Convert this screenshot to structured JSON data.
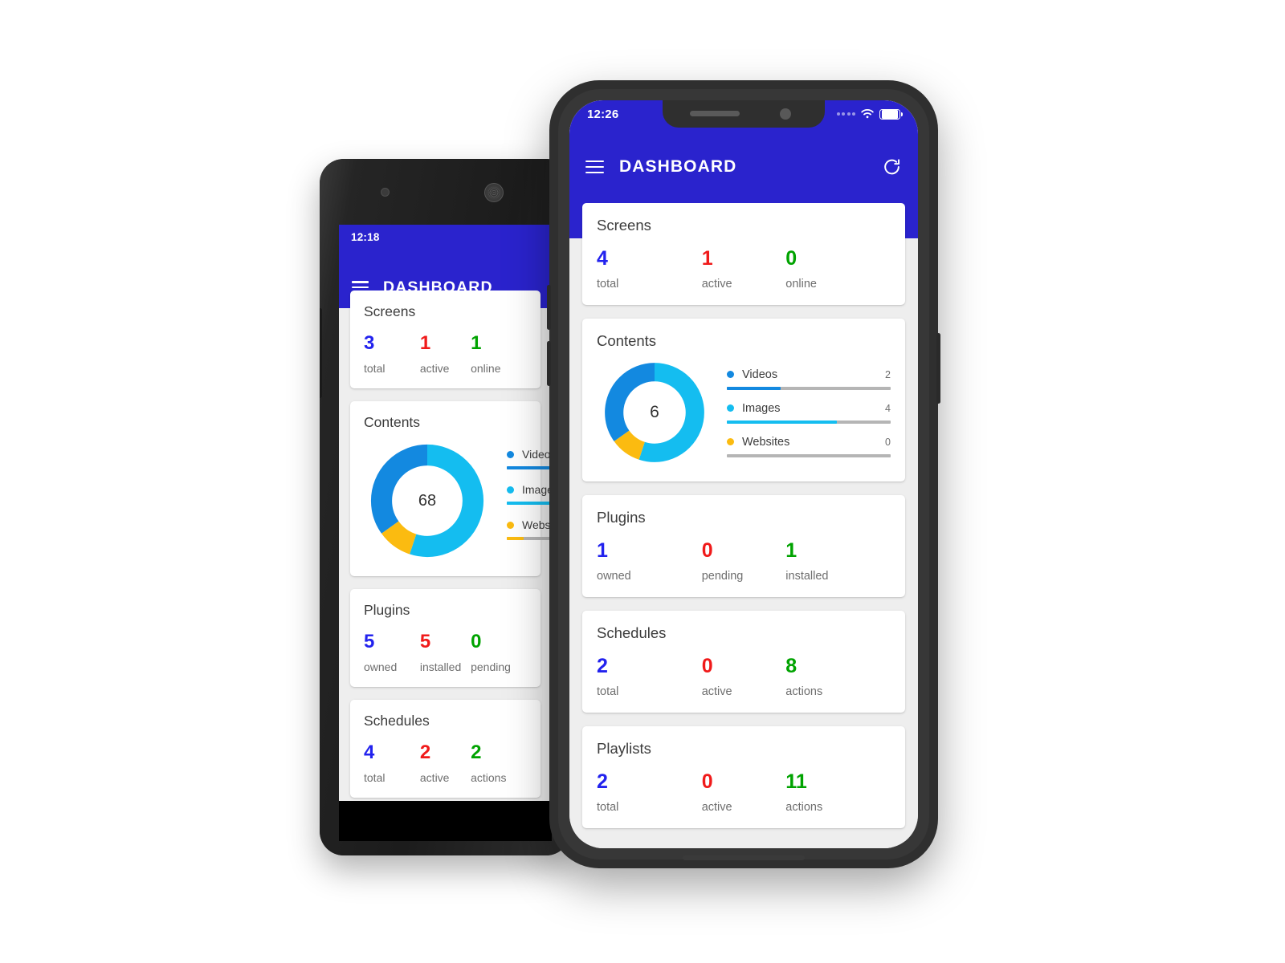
{
  "colors": {
    "brand_blue": "#2a23cd",
    "stat_blue": "#2222ee",
    "stat_red": "#f01a1a",
    "stat_green": "#00a300",
    "videos": "#1389e0",
    "images": "#14bdf0",
    "websites": "#fbbb10",
    "track": "#b5b5b5",
    "screen_bg": "#eeeeee",
    "card_bg": "#ffffff"
  },
  "iphone": {
    "status_bar": {
      "time": "12:26",
      "wifi_icon": "wifi-icon",
      "battery_icon": "battery-icon",
      "signal_icon": "signal-dots-icon"
    },
    "appbar": {
      "menu_icon": "hamburger-menu-icon",
      "title": "DASHBOARD",
      "refresh_icon": "refresh-icon"
    },
    "cards": [
      {
        "id": "screens",
        "title": "Screens",
        "type": "stats",
        "stats": [
          {
            "value": "4",
            "label": "total",
            "color": "#2222ee"
          },
          {
            "value": "1",
            "label": "active",
            "color": "#f01a1a"
          },
          {
            "value": "0",
            "label": "online",
            "color": "#00a300"
          }
        ]
      },
      {
        "id": "contents",
        "title": "Contents",
        "type": "donut",
        "center_value": "6",
        "legend": [
          {
            "name": "Videos",
            "value": "2",
            "color": "#1389e0",
            "fill_pct": 33
          },
          {
            "name": "Images",
            "value": "4",
            "color": "#14bdf0",
            "fill_pct": 67
          },
          {
            "name": "Websites",
            "value": "0",
            "color": "#fbbb10",
            "fill_pct": 0
          }
        ]
      },
      {
        "id": "plugins",
        "title": "Plugins",
        "type": "stats",
        "stats": [
          {
            "value": "1",
            "label": "owned",
            "color": "#2222ee"
          },
          {
            "value": "0",
            "label": "pending",
            "color": "#f01a1a"
          },
          {
            "value": "1",
            "label": "installed",
            "color": "#00a300"
          }
        ]
      },
      {
        "id": "schedules",
        "title": "Schedules",
        "type": "stats",
        "stats": [
          {
            "value": "2",
            "label": "total",
            "color": "#2222ee"
          },
          {
            "value": "0",
            "label": "active",
            "color": "#f01a1a"
          },
          {
            "value": "8",
            "label": "actions",
            "color": "#00a300"
          }
        ]
      },
      {
        "id": "playlists",
        "title": "Playlists",
        "type": "stats",
        "stats": [
          {
            "value": "2",
            "label": "total",
            "color": "#2222ee"
          },
          {
            "value": "0",
            "label": "active",
            "color": "#f01a1a"
          },
          {
            "value": "11",
            "label": "actions",
            "color": "#00a300"
          }
        ]
      }
    ]
  },
  "android": {
    "status_bar": {
      "time": "12:18"
    },
    "appbar": {
      "menu_icon": "hamburger-menu-icon",
      "title": "DASHBOARD"
    },
    "cards": [
      {
        "id": "screens",
        "title": "Screens",
        "type": "stats",
        "stats": [
          {
            "value": "3",
            "label": "total",
            "color": "#2222ee"
          },
          {
            "value": "1",
            "label": "active",
            "color": "#f01a1a"
          },
          {
            "value": "1",
            "label": "online",
            "color": "#00a300"
          }
        ]
      },
      {
        "id": "contents",
        "title": "Contents",
        "type": "donut",
        "center_value": "68",
        "legend": [
          {
            "name": "Videos",
            "value": "",
            "color": "#1389e0",
            "fill_pct": 100
          },
          {
            "name": "Images",
            "value": "",
            "color": "#14bdf0",
            "fill_pct": 100
          },
          {
            "name": "Websites",
            "value": "",
            "color": "#fbbb10",
            "fill_pct": 28
          }
        ]
      },
      {
        "id": "plugins",
        "title": "Plugins",
        "type": "stats",
        "stats": [
          {
            "value": "5",
            "label": "owned",
            "color": "#2222ee"
          },
          {
            "value": "5",
            "label": "installed",
            "color": "#f01a1a"
          },
          {
            "value": "0",
            "label": "pending",
            "color": "#00a300"
          }
        ]
      },
      {
        "id": "schedules",
        "title": "Schedules",
        "type": "stats",
        "stats": [
          {
            "value": "4",
            "label": "total",
            "color": "#2222ee"
          },
          {
            "value": "2",
            "label": "active",
            "color": "#f01a1a"
          },
          {
            "value": "2",
            "label": "actions",
            "color": "#00a300"
          }
        ]
      }
    ]
  },
  "chart_data": [
    {
      "type": "pie",
      "title": "Contents",
      "device": "iphone",
      "labels": [
        "Images",
        "Websites",
        "Videos"
      ],
      "values": [
        4,
        0.7,
        2.3
      ],
      "colors": [
        "#14bdf0",
        "#fbbb10",
        "#1389e0"
      ],
      "center_label": "6",
      "legend": "right",
      "note": "Donut starts at 12 o'clock clockwise: Images ~55%, Websites ~10%, Videos ~35%"
    },
    {
      "type": "pie",
      "title": "Contents",
      "device": "android",
      "labels": [
        "Images",
        "Websites",
        "Videos"
      ],
      "values": [
        55,
        10,
        35
      ],
      "colors": [
        "#14bdf0",
        "#fbbb10",
        "#1389e0"
      ],
      "center_label": "68",
      "legend": "right"
    }
  ]
}
